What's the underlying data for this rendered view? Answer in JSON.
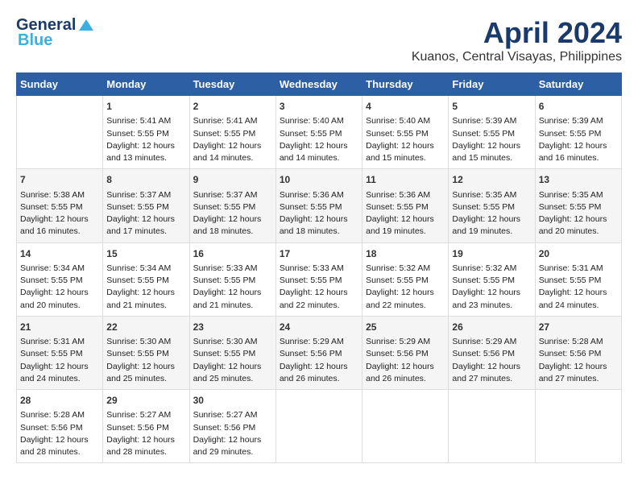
{
  "header": {
    "logo_general": "General",
    "logo_blue": "Blue",
    "month_title": "April 2024",
    "location": "Kuanos, Central Visayas, Philippines"
  },
  "weekdays": [
    "Sunday",
    "Monday",
    "Tuesday",
    "Wednesday",
    "Thursday",
    "Friday",
    "Saturday"
  ],
  "weeks": [
    [
      {
        "day": "",
        "info": ""
      },
      {
        "day": "1",
        "info": "Sunrise: 5:41 AM\nSunset: 5:55 PM\nDaylight: 12 hours\nand 13 minutes."
      },
      {
        "day": "2",
        "info": "Sunrise: 5:41 AM\nSunset: 5:55 PM\nDaylight: 12 hours\nand 14 minutes."
      },
      {
        "day": "3",
        "info": "Sunrise: 5:40 AM\nSunset: 5:55 PM\nDaylight: 12 hours\nand 14 minutes."
      },
      {
        "day": "4",
        "info": "Sunrise: 5:40 AM\nSunset: 5:55 PM\nDaylight: 12 hours\nand 15 minutes."
      },
      {
        "day": "5",
        "info": "Sunrise: 5:39 AM\nSunset: 5:55 PM\nDaylight: 12 hours\nand 15 minutes."
      },
      {
        "day": "6",
        "info": "Sunrise: 5:39 AM\nSunset: 5:55 PM\nDaylight: 12 hours\nand 16 minutes."
      }
    ],
    [
      {
        "day": "7",
        "info": "Sunrise: 5:38 AM\nSunset: 5:55 PM\nDaylight: 12 hours\nand 16 minutes."
      },
      {
        "day": "8",
        "info": "Sunrise: 5:37 AM\nSunset: 5:55 PM\nDaylight: 12 hours\nand 17 minutes."
      },
      {
        "day": "9",
        "info": "Sunrise: 5:37 AM\nSunset: 5:55 PM\nDaylight: 12 hours\nand 18 minutes."
      },
      {
        "day": "10",
        "info": "Sunrise: 5:36 AM\nSunset: 5:55 PM\nDaylight: 12 hours\nand 18 minutes."
      },
      {
        "day": "11",
        "info": "Sunrise: 5:36 AM\nSunset: 5:55 PM\nDaylight: 12 hours\nand 19 minutes."
      },
      {
        "day": "12",
        "info": "Sunrise: 5:35 AM\nSunset: 5:55 PM\nDaylight: 12 hours\nand 19 minutes."
      },
      {
        "day": "13",
        "info": "Sunrise: 5:35 AM\nSunset: 5:55 PM\nDaylight: 12 hours\nand 20 minutes."
      }
    ],
    [
      {
        "day": "14",
        "info": "Sunrise: 5:34 AM\nSunset: 5:55 PM\nDaylight: 12 hours\nand 20 minutes."
      },
      {
        "day": "15",
        "info": "Sunrise: 5:34 AM\nSunset: 5:55 PM\nDaylight: 12 hours\nand 21 minutes."
      },
      {
        "day": "16",
        "info": "Sunrise: 5:33 AM\nSunset: 5:55 PM\nDaylight: 12 hours\nand 21 minutes."
      },
      {
        "day": "17",
        "info": "Sunrise: 5:33 AM\nSunset: 5:55 PM\nDaylight: 12 hours\nand 22 minutes."
      },
      {
        "day": "18",
        "info": "Sunrise: 5:32 AM\nSunset: 5:55 PM\nDaylight: 12 hours\nand 22 minutes."
      },
      {
        "day": "19",
        "info": "Sunrise: 5:32 AM\nSunset: 5:55 PM\nDaylight: 12 hours\nand 23 minutes."
      },
      {
        "day": "20",
        "info": "Sunrise: 5:31 AM\nSunset: 5:55 PM\nDaylight: 12 hours\nand 24 minutes."
      }
    ],
    [
      {
        "day": "21",
        "info": "Sunrise: 5:31 AM\nSunset: 5:55 PM\nDaylight: 12 hours\nand 24 minutes."
      },
      {
        "day": "22",
        "info": "Sunrise: 5:30 AM\nSunset: 5:55 PM\nDaylight: 12 hours\nand 25 minutes."
      },
      {
        "day": "23",
        "info": "Sunrise: 5:30 AM\nSunset: 5:55 PM\nDaylight: 12 hours\nand 25 minutes."
      },
      {
        "day": "24",
        "info": "Sunrise: 5:29 AM\nSunset: 5:56 PM\nDaylight: 12 hours\nand 26 minutes."
      },
      {
        "day": "25",
        "info": "Sunrise: 5:29 AM\nSunset: 5:56 PM\nDaylight: 12 hours\nand 26 minutes."
      },
      {
        "day": "26",
        "info": "Sunrise: 5:29 AM\nSunset: 5:56 PM\nDaylight: 12 hours\nand 27 minutes."
      },
      {
        "day": "27",
        "info": "Sunrise: 5:28 AM\nSunset: 5:56 PM\nDaylight: 12 hours\nand 27 minutes."
      }
    ],
    [
      {
        "day": "28",
        "info": "Sunrise: 5:28 AM\nSunset: 5:56 PM\nDaylight: 12 hours\nand 28 minutes."
      },
      {
        "day": "29",
        "info": "Sunrise: 5:27 AM\nSunset: 5:56 PM\nDaylight: 12 hours\nand 28 minutes."
      },
      {
        "day": "30",
        "info": "Sunrise: 5:27 AM\nSunset: 5:56 PM\nDaylight: 12 hours\nand 29 minutes."
      },
      {
        "day": "",
        "info": ""
      },
      {
        "day": "",
        "info": ""
      },
      {
        "day": "",
        "info": ""
      },
      {
        "day": "",
        "info": ""
      }
    ]
  ]
}
